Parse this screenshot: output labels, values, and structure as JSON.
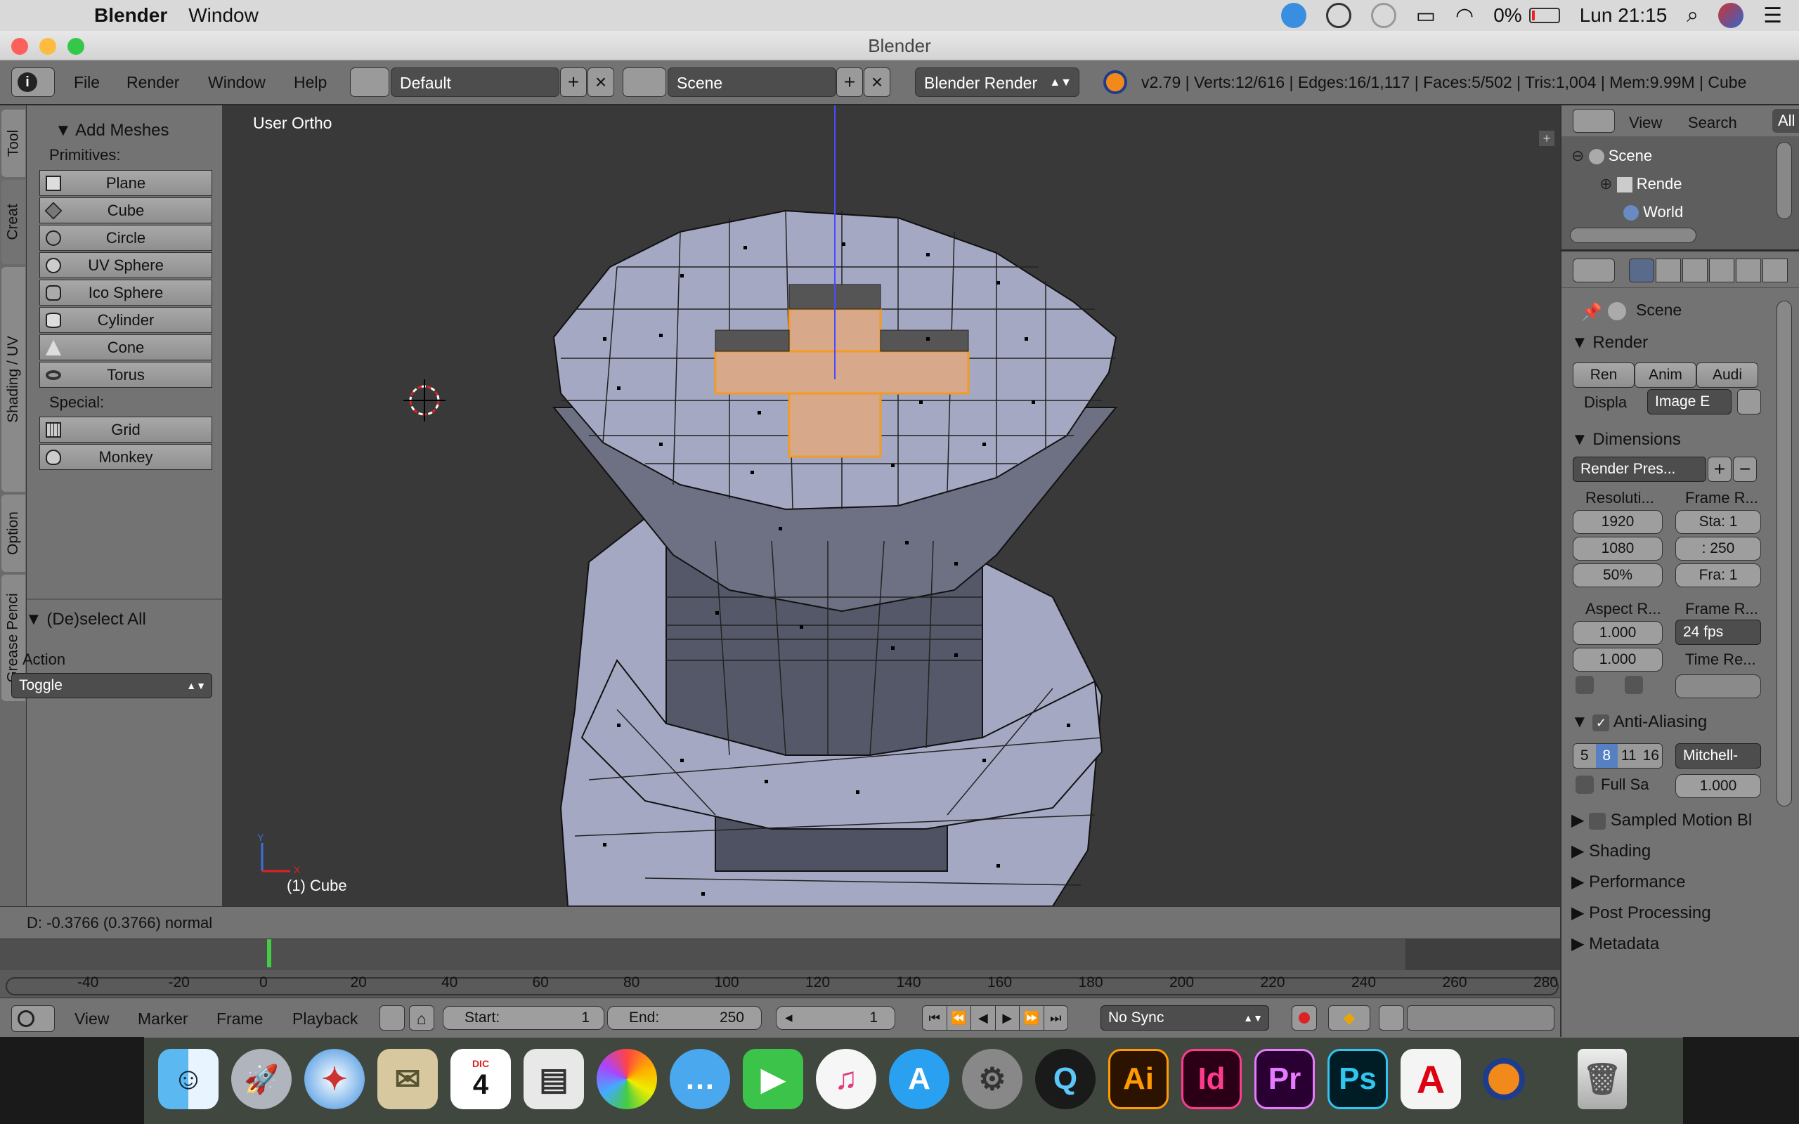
{
  "mac_menubar": {
    "app": "Blender",
    "menu": [
      "Window"
    ],
    "battery": "0%",
    "clock": "Lun 21:15"
  },
  "window": {
    "title": "Blender"
  },
  "header": {
    "menus": [
      "File",
      "Render",
      "Window",
      "Help"
    ],
    "layout": "Default",
    "scene": "Scene",
    "engine": "Blender Render",
    "stats": "v2.79 | Verts:12/616 | Edges:16/1,117 | Faces:5/502 | Tris:1,004 | Mem:9.99M | Cube"
  },
  "tool_tabs": [
    "Tool",
    "Creat",
    "Shading / UV",
    "Option",
    "Grease Penci"
  ],
  "tool_shelf": {
    "panel_title": "Add Meshes",
    "primitives_label": "Primitives:",
    "primitives": [
      "Plane",
      "Cube",
      "Circle",
      "UV Sphere",
      "Ico Sphere",
      "Cylinder",
      "Cone",
      "Torus"
    ],
    "special_label": "Special:",
    "special": [
      "Grid",
      "Monkey"
    ],
    "op_panel_title": "(De)select All",
    "action_label": "Action",
    "action_value": "Toggle"
  },
  "viewport": {
    "view_name": "User Ortho",
    "object_label": "(1) Cube",
    "axis_y": "Y",
    "axis_x": "X"
  },
  "info": {
    "text": "D: -0.3766 (0.3766) normal"
  },
  "timeline": {
    "ticks": [
      "-40",
      "-20",
      "0",
      "20",
      "40",
      "60",
      "80",
      "100",
      "120",
      "140",
      "160",
      "180",
      "200",
      "220",
      "240",
      "260",
      "280"
    ],
    "current_frame": 1
  },
  "timeline_footer": {
    "menus": [
      "View",
      "Marker",
      "Frame",
      "Playback"
    ],
    "start_label": "Start:",
    "start_value": "1",
    "end_label": "End:",
    "end_value": "250",
    "frame_value": "1",
    "sync": "No Sync"
  },
  "outliner": {
    "menus": [
      "View",
      "Search",
      "All"
    ],
    "items": [
      "Scene",
      "Rende",
      "World"
    ]
  },
  "properties": {
    "context": "Scene",
    "render_section": "Render",
    "render_buttons": [
      "Ren",
      "Anim",
      "Audi"
    ],
    "display_label": "Displa",
    "display_value": "Image E",
    "dimensions_section": "Dimensions",
    "render_presets": "Render Pres...",
    "resolution_label": "Resoluti...",
    "res_x": "1920",
    "res_y": "1080",
    "res_pct": "50%",
    "frame_range_label": "Frame R...",
    "frame_start": "Sta: 1",
    "frame_end": ": 250",
    "frame_step": "Fra: 1",
    "aspect_label": "Aspect R...",
    "aspect_x": "1.000",
    "aspect_y": "1.000",
    "frame_rate_label": "Frame R...",
    "fps": "24 fps",
    "time_remap_label": "Time Re...",
    "aa_section": "Anti-Aliasing",
    "aa_samples": [
      "5",
      "8",
      "11",
      "16"
    ],
    "aa_selected": "8",
    "aa_filter": "Mitchell-",
    "full_sample_label": "Full Sa",
    "filter_size": "1.000",
    "sampled_motion": "Sampled Motion Bl",
    "collapsed_sections": [
      "Shading",
      "Performance",
      "Post Processing",
      "Metadata"
    ]
  },
  "dock": {
    "apps": [
      "Finder",
      "Launchpad",
      "Safari",
      "Mail",
      "Calendar",
      "Preview",
      "Photos",
      "Messages",
      "FaceTime",
      "iTunes",
      "App Store",
      "System Preferences",
      "QuickTime",
      "Ai",
      "Id",
      "Pr",
      "Ps",
      "Acrobat",
      "Blender",
      "Trash"
    ],
    "calendar_month": "DIC",
    "calendar_day": "4"
  },
  "colors": {
    "selection_orange": "#f59a23",
    "mesh_face": "#a5a8c2",
    "viewport_bg": "#393939"
  }
}
